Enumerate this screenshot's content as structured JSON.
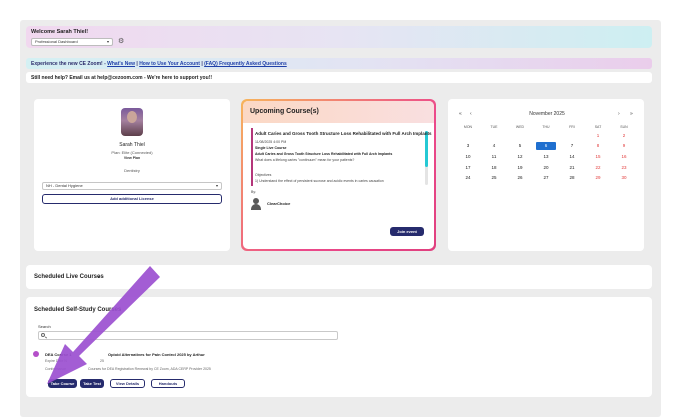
{
  "header": {
    "welcome": "Welcome Sarah Thiel!",
    "dashboard_select": "Professional Dashboard"
  },
  "banner": {
    "prefix": "Experience the new CE Zoom! - ",
    "link1": "What's New",
    "link2": "How to Use Your Account",
    "link3": "(FAQ) Frequently Asked Questions",
    "sep": " | "
  },
  "help": {
    "text": "Still need help? Email us at help@cezoom.com - We're here to support you!!"
  },
  "profile": {
    "name": "Sarah Thiel",
    "plan": "Plan: Elite (Connected)",
    "view_plan": "View Plan",
    "profession": "Dentistry",
    "license_select": "NH - Dental Hygiene",
    "add_license": "Add additional License"
  },
  "upcoming": {
    "title": "Upcoming Course(s)",
    "course_title": "Adult Caries and Gross Tooth Structure Loss Rehabilitated with Full Arch Implants",
    "date": "11/08/2025 4:00 PM",
    "type": "Single Live Course",
    "course_title2": "Adult Caries and Gross Tooth Structure Loss Rehabilitated with Full Arch Implants",
    "desc": "What does a lifelong caries \"continuum\" mean for your patients?",
    "objectives_label": "Objectives",
    "objective1": "1)   Understand the effect of persistent sucrose and acidic events in caries causation",
    "by_label": "By:",
    "teacher": "ClearChoice",
    "join": "Join event"
  },
  "calendar": {
    "nav_prev_year": "«",
    "nav_prev": "‹",
    "nav_next": "›",
    "nav_next_year": "»",
    "month": "November 2025",
    "dow": [
      "MON",
      "TUE",
      "WED",
      "THU",
      "FRI",
      "SAT",
      "SUN"
    ],
    "weeks": [
      [
        "",
        "",
        "",
        "",
        "",
        "1",
        "2"
      ],
      [
        "3",
        "4",
        "5",
        "6",
        "7",
        "8",
        "9"
      ],
      [
        "10",
        "11",
        "12",
        "13",
        "14",
        "15",
        "16"
      ],
      [
        "17",
        "18",
        "19",
        "20",
        "21",
        "22",
        "23"
      ],
      [
        "24",
        "25",
        "26",
        "27",
        "28",
        "29",
        "30"
      ]
    ],
    "today": "6"
  },
  "scheduled_live": {
    "title": "Scheduled Live Courses",
    "chevron": "⌄"
  },
  "self_study": {
    "title": "Scheduled Self-Study Courses",
    "search_label": "Search",
    "course_title": "DEA Course 1: Non-Opioid Alternatives for Pain Control 2025 by Arthur",
    "course_title_visible": "DEA Course 1",
    "course_title_rest": "Opioid Alternatives for Pain Control 2025 by Arthur",
    "expires": "Expire Date N",
    "expires_rest": "25",
    "conformance": "Conformance",
    "conformance_rest": "Courses for DEA Registration Renewal by CE Zoom, ADA CERP Provider 2025",
    "buttons": {
      "take_course": "Take Course",
      "take_test": "Take Test",
      "view_details": "View Details",
      "handouts": "Handouts"
    }
  },
  "colors": {
    "navy": "#262b6d",
    "accent_pink": "#ec4a8b",
    "arrow_purple": "#9b4fd0",
    "today_blue": "#1f6fcf",
    "weekend_red": "#e23b3b"
  }
}
